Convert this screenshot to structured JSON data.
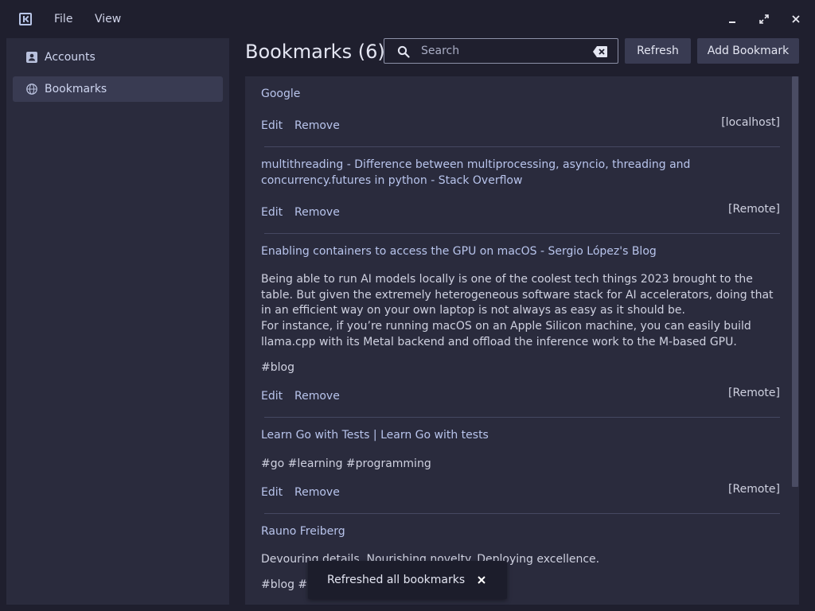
{
  "menu": {
    "file": "File",
    "view": "View"
  },
  "window_controls": {
    "minimize": "–",
    "maximize": "⤢",
    "close": "✕"
  },
  "sidebar": {
    "items": [
      {
        "label": "Accounts",
        "icon": "account-icon",
        "active": false
      },
      {
        "label": "Bookmarks",
        "icon": "globe-icon",
        "active": true
      }
    ]
  },
  "header": {
    "title": "Bookmarks (6)",
    "search_placeholder": "Search",
    "search_value": "",
    "refresh_label": "Refresh",
    "add_label": "Add Bookmark"
  },
  "bookmarks": [
    {
      "title": "Google",
      "source": "[localhost]",
      "edit": "Edit",
      "remove": "Remove"
    },
    {
      "title": "multithreading - Difference between multiprocessing, asyncio, threading and concurrency.futures in python - Stack Overflow",
      "source": "[Remote]",
      "edit": "Edit",
      "remove": "Remove"
    },
    {
      "title": "Enabling containers to access the GPU on macOS - Sergio López's Blog",
      "description_1": "Being able to run AI models locally is one of the coolest tech things 2023 brought to the table. But given the extremely heterogeneous software stack for AI accelerators, doing that in an efficient way on your own laptop is not always as easy as it should be.",
      "description_2": "For instance, if you’re running macOS on an Apple Silicon machine, you can easily build llama.cpp with its Metal backend and offload the inference work to the M-based GPU.",
      "tags": "#blog",
      "source": "[Remote]",
      "edit": "Edit",
      "remove": "Remove"
    },
    {
      "title": "Learn Go with Tests | Learn Go with tests",
      "tags": "#go #learning #programming",
      "source": "[Remote]",
      "edit": "Edit",
      "remove": "Remove"
    },
    {
      "title": "Rauno Freiberg",
      "description_1": "Devouring details. Nourishing novelty. Deploying excellence.",
      "tags": "#blog #d"
    }
  ],
  "snackbar": {
    "text": "Refreshed all bookmarks",
    "close": "✕"
  },
  "colors": {
    "background": "#1f1f2e",
    "panel": "#2a2b3d",
    "button": "#393b52",
    "accent_link": "#b8c4ec"
  }
}
